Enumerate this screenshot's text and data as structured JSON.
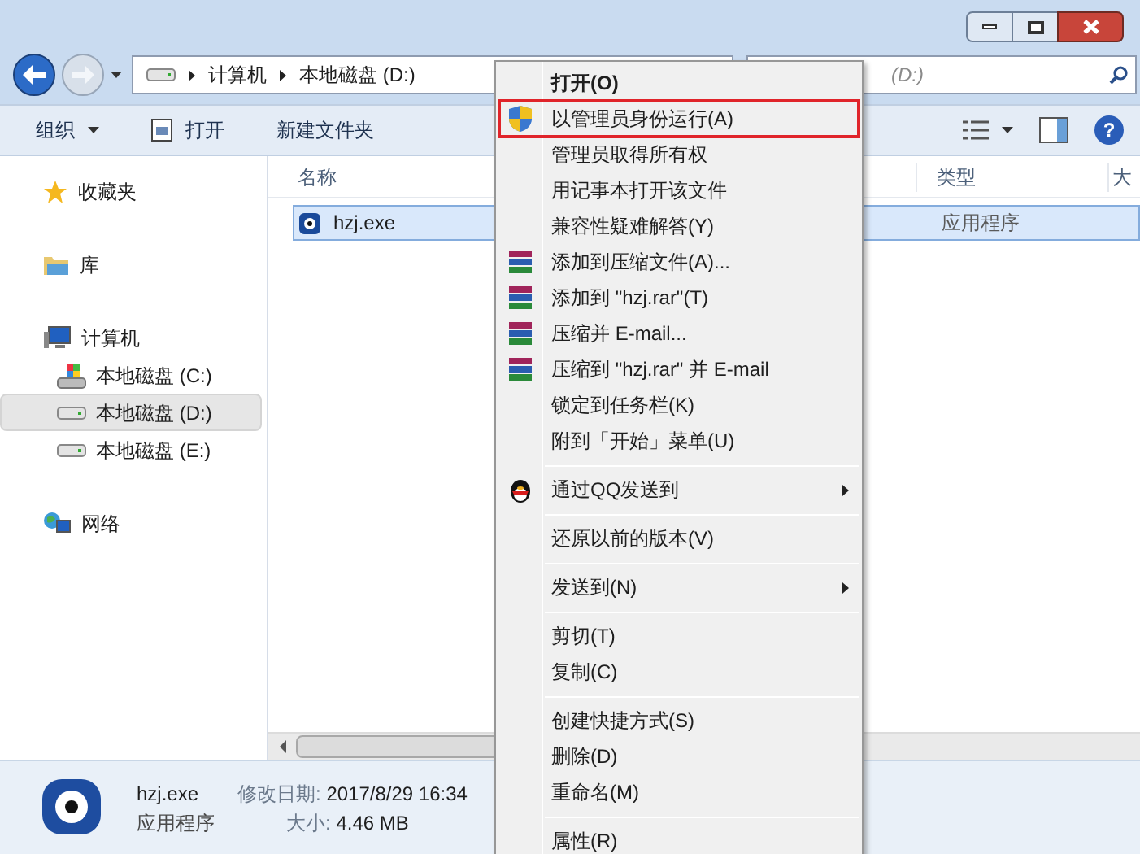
{
  "address_bar": {
    "segments": [
      "计算机",
      "本地磁盘 (D:)"
    ]
  },
  "search": {
    "placeholder": "(D:)"
  },
  "toolbar": {
    "organize": "组织",
    "open": "打开",
    "new_folder": "新建文件夹",
    "help": "?"
  },
  "sidebar": {
    "items": [
      {
        "label": "收藏夹",
        "selected": false
      },
      {
        "label": "库",
        "selected": false
      },
      {
        "label": "计算机",
        "selected": false,
        "children": [
          {
            "label": "本地磁盘 (C:)",
            "selected": false
          },
          {
            "label": "本地磁盘 (D:)",
            "selected": true
          },
          {
            "label": "本地磁盘 (E:)",
            "selected": false
          }
        ]
      },
      {
        "label": "网络",
        "selected": false
      }
    ]
  },
  "table": {
    "columns": [
      "名称",
      "类型",
      "大"
    ],
    "rows": [
      {
        "name": "hzj.exe",
        "type": "应用程序",
        "selected": true
      }
    ]
  },
  "details": {
    "name": "hzj.exe",
    "type": "应用程序",
    "modified_label": "修改日期:",
    "modified": "2017/8/29 16:34",
    "size_label": "大小:",
    "size": "4.46 MB"
  },
  "context_menu": {
    "items": [
      {
        "kind": "item",
        "label": "打开(O)",
        "default": true,
        "highlighted": false,
        "submenu": false
      },
      {
        "kind": "item",
        "label": "以管理员身份运行(A)",
        "default": false,
        "highlighted": true,
        "submenu": false
      },
      {
        "kind": "item",
        "label": "管理员取得所有权",
        "default": false,
        "highlighted": false,
        "submenu": false
      },
      {
        "kind": "item",
        "label": "用记事本打开该文件",
        "default": false,
        "highlighted": false,
        "submenu": false
      },
      {
        "kind": "item",
        "label": "兼容性疑难解答(Y)",
        "default": false,
        "highlighted": false,
        "submenu": false
      },
      {
        "kind": "item",
        "label": "添加到压缩文件(A)...",
        "default": false,
        "highlighted": false,
        "submenu": false
      },
      {
        "kind": "item",
        "label": "添加到 \"hzj.rar\"(T)",
        "default": false,
        "highlighted": false,
        "submenu": false
      },
      {
        "kind": "item",
        "label": "压缩并 E-mail...",
        "default": false,
        "highlighted": false,
        "submenu": false
      },
      {
        "kind": "item",
        "label": "压缩到 \"hzj.rar\" 并 E-mail",
        "default": false,
        "highlighted": false,
        "submenu": false
      },
      {
        "kind": "item",
        "label": "锁定到任务栏(K)",
        "default": false,
        "highlighted": false,
        "submenu": false
      },
      {
        "kind": "item",
        "label": "附到「开始」菜单(U)",
        "default": false,
        "highlighted": false,
        "submenu": false
      },
      {
        "kind": "separator"
      },
      {
        "kind": "item",
        "label": "通过QQ发送到",
        "default": false,
        "highlighted": false,
        "submenu": true
      },
      {
        "kind": "separator"
      },
      {
        "kind": "item",
        "label": "还原以前的版本(V)",
        "default": false,
        "highlighted": false,
        "submenu": false
      },
      {
        "kind": "separator"
      },
      {
        "kind": "item",
        "label": "发送到(N)",
        "default": false,
        "highlighted": false,
        "submenu": true
      },
      {
        "kind": "separator"
      },
      {
        "kind": "item",
        "label": "剪切(T)",
        "default": false,
        "highlighted": false,
        "submenu": false
      },
      {
        "kind": "item",
        "label": "复制(C)",
        "default": false,
        "highlighted": false,
        "submenu": false
      },
      {
        "kind": "separator"
      },
      {
        "kind": "item",
        "label": "创建快捷方式(S)",
        "default": false,
        "highlighted": false,
        "submenu": false
      },
      {
        "kind": "item",
        "label": "删除(D)",
        "default": false,
        "highlighted": false,
        "submenu": false
      },
      {
        "kind": "item",
        "label": "重命名(M)",
        "default": false,
        "highlighted": false,
        "submenu": false
      },
      {
        "kind": "separator"
      },
      {
        "kind": "item",
        "label": "属性(R)",
        "default": false,
        "highlighted": false,
        "submenu": false
      }
    ]
  }
}
